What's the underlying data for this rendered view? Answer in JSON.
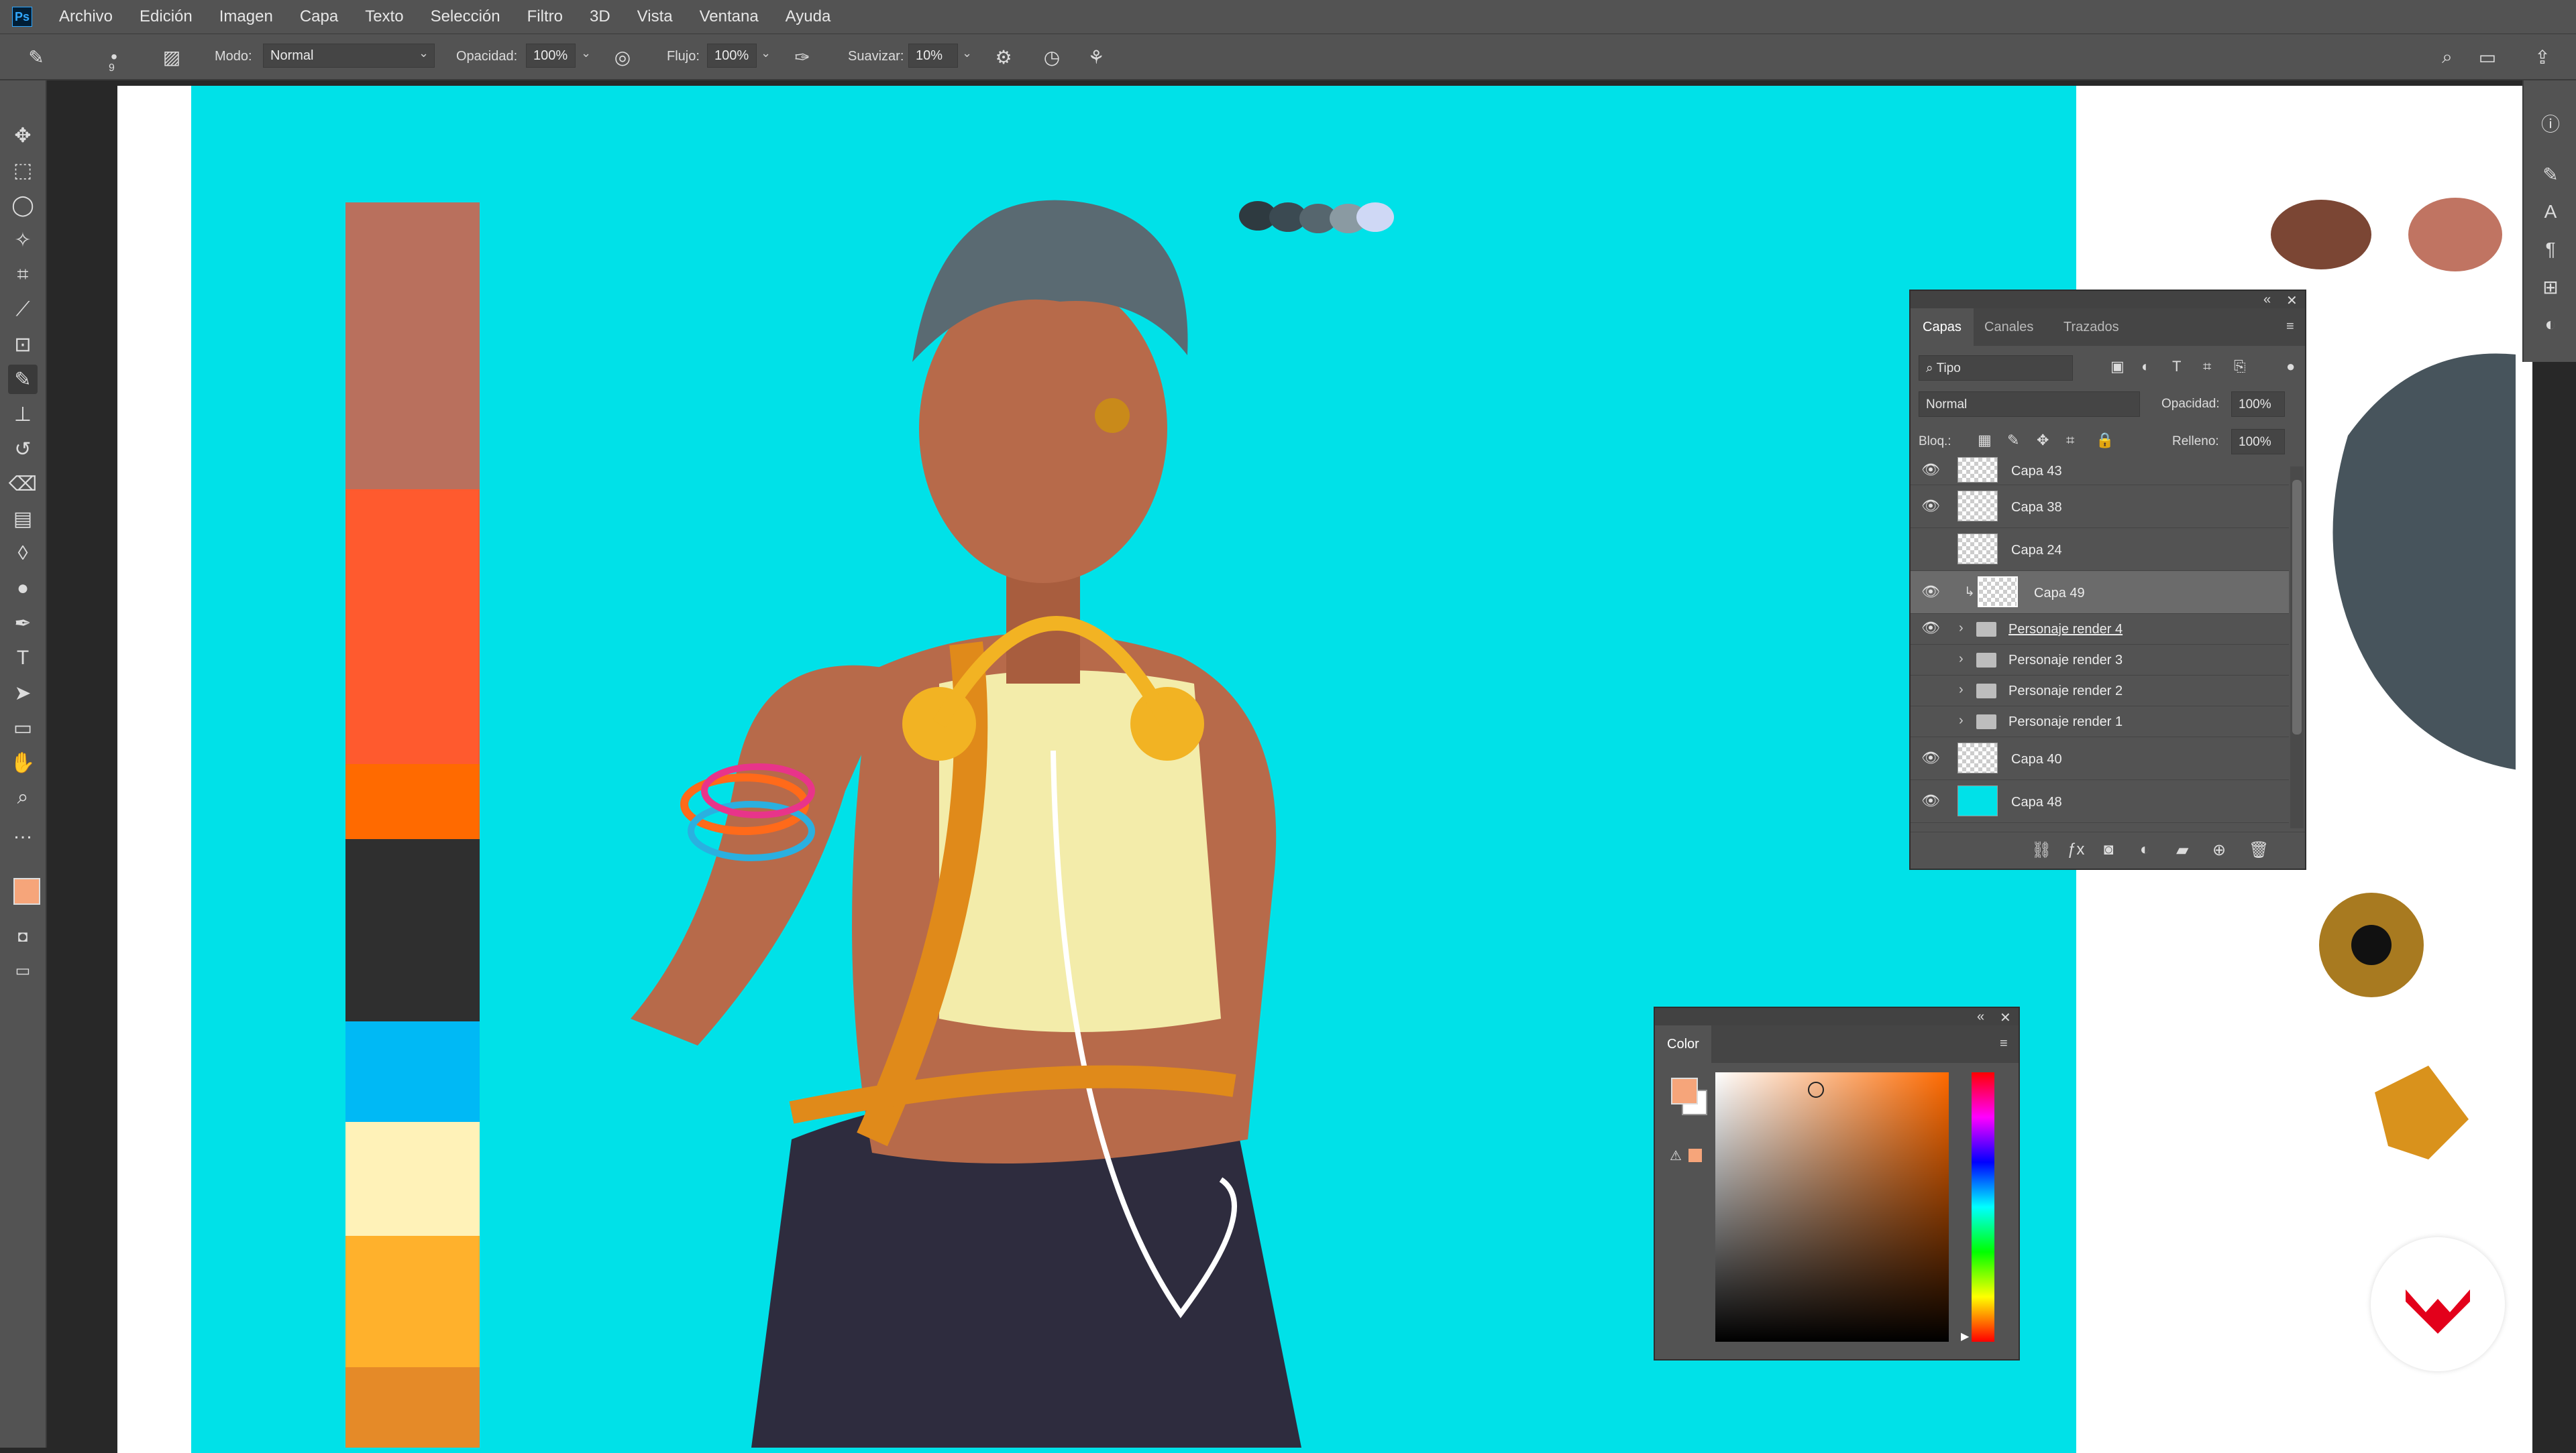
{
  "app": {
    "logo_text": "Ps"
  },
  "menu": [
    "Archivo",
    "Edición",
    "Imagen",
    "Capa",
    "Texto",
    "Selección",
    "Filtro",
    "3D",
    "Vista",
    "Ventana",
    "Ayuda"
  ],
  "options_bar": {
    "brush_size": "9",
    "mode_label": "Modo:",
    "mode_value": "Normal",
    "opacity_label": "Opacidad:",
    "opacity_value": "100%",
    "flow_label": "Flujo:",
    "flow_value": "100%",
    "smoothing_label": "Suavizar:",
    "smoothing_value": "10%"
  },
  "layers_panel": {
    "tabs": [
      "Capas",
      "Canales",
      "Trazados"
    ],
    "filter_label": "Tipo",
    "blend_mode": "Normal",
    "opacity_label": "Opacidad:",
    "opacity_value": "100%",
    "lock_label": "Bloq.:",
    "fill_label": "Relleno:",
    "fill_value": "100%",
    "layers": [
      {
        "name": "Capa 43",
        "visible": true,
        "kind": "layer"
      },
      {
        "name": "Capa 38",
        "visible": true,
        "kind": "layer"
      },
      {
        "name": "Capa 24",
        "visible": false,
        "kind": "layer"
      },
      {
        "name": "Capa 49",
        "visible": true,
        "kind": "layer",
        "selected": true
      },
      {
        "name": "Personaje render 4",
        "visible": true,
        "kind": "group"
      },
      {
        "name": "Personaje render 3",
        "visible": false,
        "kind": "group"
      },
      {
        "name": "Personaje render 2",
        "visible": false,
        "kind": "group"
      },
      {
        "name": "Personaje render 1",
        "visible": false,
        "kind": "group"
      },
      {
        "name": "Capa 40",
        "visible": true,
        "kind": "layer"
      },
      {
        "name": "Capa 48",
        "visible": true,
        "kind": "layer",
        "thumb": "#00e1e8"
      }
    ]
  },
  "color_panel": {
    "tab": "Color",
    "foreground": "#f6a57a",
    "background": "#ffffff"
  },
  "canvas": {
    "background_color": "#00e1e8",
    "palette": [
      "#b9705d",
      "#ff5a2e",
      "#ff6a00",
      "#2f2f2f",
      "#00b9f5",
      "#fff2b8",
      "#ffb12c",
      "#e58a28"
    ]
  },
  "icons": {
    "tools": [
      "move-icon",
      "marquee-icon",
      "lasso-icon",
      "magic-wand-icon",
      "crop-icon",
      "eyedropper-icon",
      "frame-icon",
      "brush-icon",
      "stamp-icon",
      "history-brush-icon",
      "eraser-icon",
      "gradient-icon",
      "blur-icon",
      "dodge-icon",
      "pen-icon",
      "type-icon",
      "path-select-icon",
      "rectangle-icon",
      "hand-icon",
      "zoom-icon",
      "more-icon"
    ]
  }
}
